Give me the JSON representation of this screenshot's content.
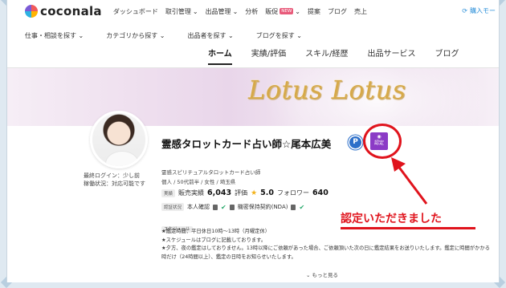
{
  "header": {
    "logo": "coconala",
    "nav_items": [
      {
        "label": "ダッシュボード",
        "dropdown": false
      },
      {
        "label": "取引管理",
        "dropdown": true
      },
      {
        "label": "出品管理",
        "dropdown": true
      },
      {
        "label": "分析",
        "dropdown": false
      },
      {
        "label": "販促",
        "dropdown": true,
        "badge": "NEW"
      },
      {
        "label": "提案",
        "dropdown": false
      },
      {
        "label": "ブログ",
        "dropdown": false
      },
      {
        "label": "売上",
        "dropdown": false
      }
    ],
    "switch_mode": "購入モー"
  },
  "subnav": [
    "仕事・相談を探す",
    "カテゴリから探す",
    "出品者を探す",
    "ブログを探す"
  ],
  "tabs": [
    "ホーム",
    "実績/評価",
    "スキル/経歴",
    "出品サービス",
    "ブログ"
  ],
  "banner": {
    "title": "Lotus Lotus"
  },
  "profile": {
    "name": "霊感タロットカード占い師☆尾本広美",
    "last_login": "最終ログイン：少し前",
    "status": "稼働状況：対応可能です",
    "occupation": "霊感スピリチュアルタロットカード占い師",
    "demographics": "個人 / 50代前半 / 女性 / 埼玉県",
    "achievements_label": "実績",
    "sales_label": "販売実績",
    "sales_count": "6,043",
    "rating_label": "評価",
    "rating": "5.0",
    "followers_label": "フォロワー",
    "followers": "640",
    "verification_label": "認証状況",
    "identity_verified": "本人確認",
    "nda": "機密保持契約(NDA)",
    "schedule_label": "スケジュール",
    "schedule_lines": [
      "★鑑定時間：平日休日10時〜13時（月曜定休）",
      "★スケジュールはブログに記載しております。",
      "★夕方、夜の鑑定はしておりません。13時以降にご依頼があった場合、ご依頼頂いた次の日に鑑定結果をお送りいたします。鑑定に時間がかかる時だけ（24時間以上）、鑑定の日時をお知らせいたします。"
    ],
    "show_more": "もっと見る",
    "pro_badge_letter": "P",
    "cert_badge_label": "認定"
  },
  "annotation": {
    "text": "認定いただきました",
    "color": "#e0131c"
  },
  "colors": {
    "accent": "#2b8fd9",
    "cert_purple": "#8b3bc6",
    "annotation_red": "#e0131c"
  }
}
